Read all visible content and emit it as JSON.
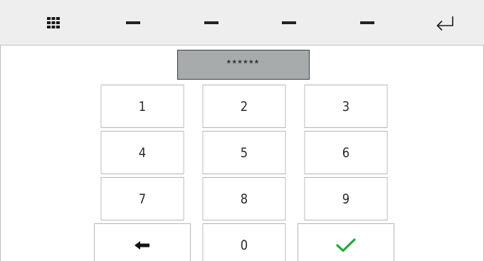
{
  "toolbar": {
    "keyboard_icon": "grid-keypad-icon",
    "enter_icon": "return-arrow-icon",
    "slots": [
      "dash-icon",
      "dash-icon",
      "dash-icon",
      "dash-icon"
    ]
  },
  "password_field": {
    "value": "******"
  },
  "keypad": {
    "keys": [
      "1",
      "2",
      "3",
      "4",
      "5",
      "6",
      "7",
      "8",
      "9",
      "0"
    ],
    "backspace_icon": "backspace-arrow-icon",
    "confirm_icon": "checkmark-icon"
  },
  "colors": {
    "toolbar_bg": "#eeeeee",
    "field_bg": "#a8abab",
    "confirm": "#22a83a",
    "key_border": "#b5b5b5"
  }
}
